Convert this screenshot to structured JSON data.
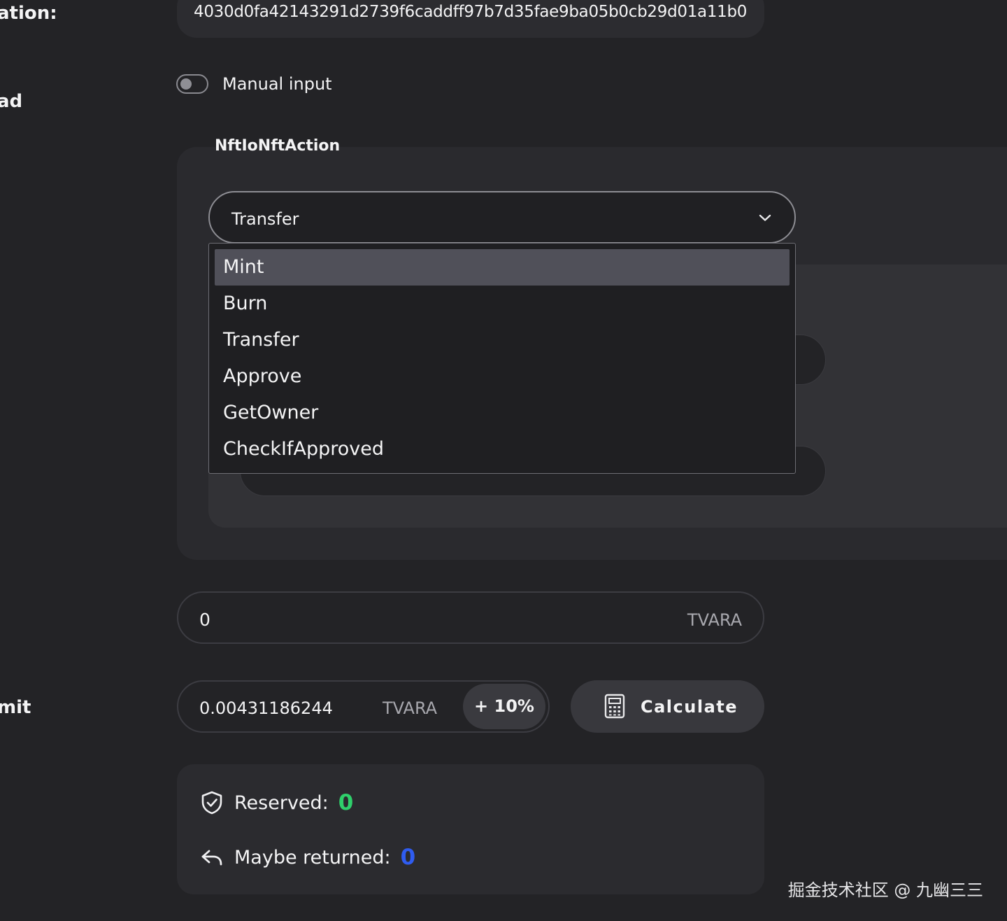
{
  "labels": {
    "destination": "ation:",
    "payload": "ad",
    "gas_limit": "mit"
  },
  "destination": {
    "value": "4030d0fa42143291d2739f6caddff97b7d35fae9ba05b0cb29d01a11b0"
  },
  "manual_input": {
    "label": "Manual input",
    "enabled": false
  },
  "payload": {
    "type_name": "NftIoNftAction",
    "selected": "Transfer",
    "options": [
      "Mint",
      "Burn",
      "Transfer",
      "Approve",
      "GetOwner",
      "CheckIfApproved"
    ],
    "highlighted_option": "Mint"
  },
  "value": {
    "amount": "0",
    "unit": "TVARA"
  },
  "gas": {
    "amount": "0.00431186244",
    "unit": "TVARA",
    "increase_label": "+ 10%",
    "calculate_label": "Calculate"
  },
  "info": {
    "reserved_label": "Reserved:",
    "reserved_value": "0",
    "maybe_returned_label": "Maybe returned:",
    "maybe_returned_value": "0"
  },
  "colors": {
    "reserved": "#2fd06b",
    "maybe_returned": "#2f5cf0",
    "background": "#232326"
  },
  "watermark": "掘金技术社区 @ 九幽三三"
}
